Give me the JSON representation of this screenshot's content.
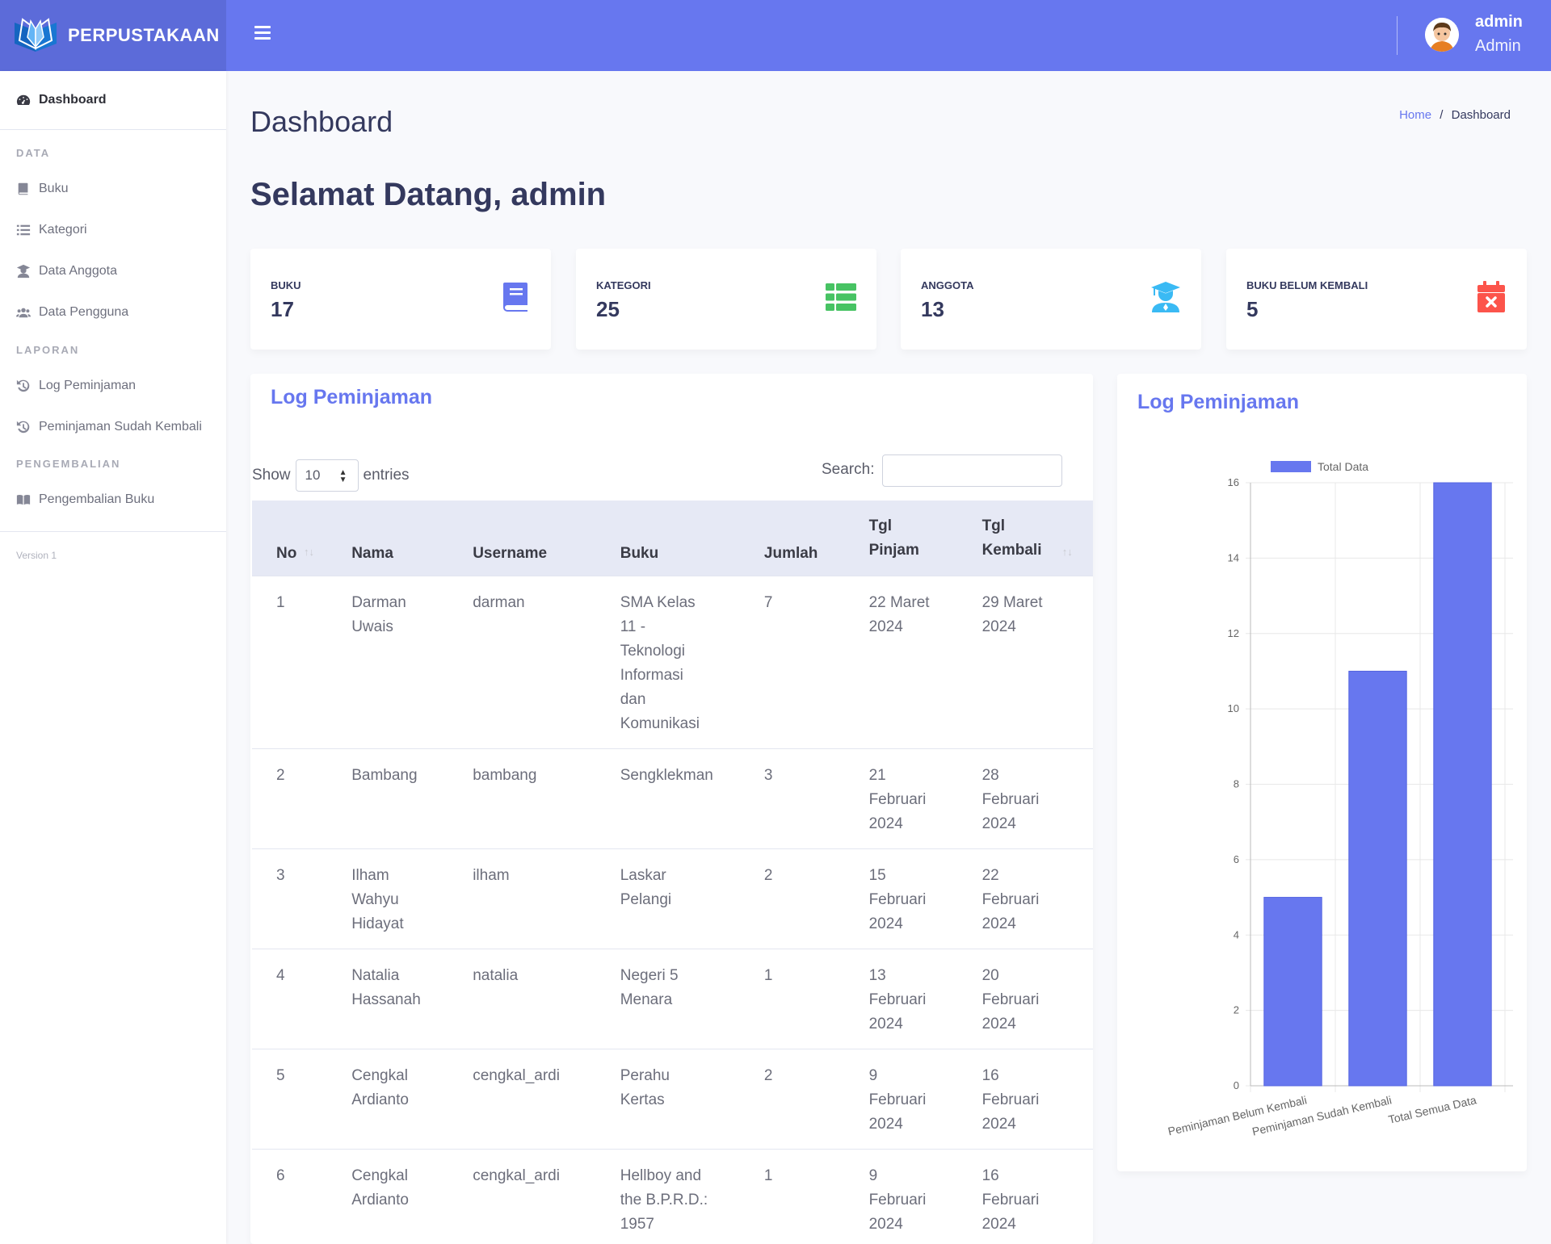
{
  "app": {
    "brand": "PERPUSTAKAAN"
  },
  "user": {
    "name": "admin",
    "role": "Admin"
  },
  "sidebar": {
    "dashboard": "Dashboard",
    "data_heading": "DATA",
    "items_data": [
      "Buku",
      "Kategori",
      "Data Anggota",
      "Data Pengguna"
    ],
    "laporan_heading": "LAPORAN",
    "items_laporan": [
      "Log Peminjaman",
      "Peminjaman Sudah Kembali"
    ],
    "pengembalian_heading": "PENGEMBALIAN",
    "items_pengembalian": [
      "Pengembalian Buku"
    ],
    "version": "Version 1"
  },
  "page": {
    "title": "Dashboard",
    "welcome": "Selamat Datang, admin"
  },
  "breadcrumb": {
    "home": "Home",
    "separator": "/",
    "current": "Dashboard"
  },
  "stats": [
    {
      "label": "BUKU",
      "value": "17",
      "color": "#6777ef",
      "icon": "book-icon"
    },
    {
      "label": "KATEGORI",
      "value": "25",
      "color": "#63ed7a",
      "icon": "table-list-icon"
    },
    {
      "label": "ANGGOTA",
      "value": "13",
      "color": "#3abaf4",
      "icon": "user-graduate-icon"
    },
    {
      "label": "BUKU BELUM KEMBALI",
      "value": "5",
      "color": "#fc544b",
      "icon": "calendar-x-icon"
    }
  ],
  "log_table": {
    "title": "Log Peminjaman",
    "show_label": "Show",
    "page_size": "10",
    "entries_label": "entries",
    "search_label": "Search:",
    "columns": [
      "No",
      "Nama",
      "Username",
      "Buku",
      "Jumlah",
      "Tgl Pinjam",
      "Tgl Kembali"
    ],
    "rows": [
      {
        "no": "1",
        "nama": "Darman Uwais",
        "username": "darman",
        "buku": "SMA Kelas 11 - Teknologi Informasi dan Komunikasi",
        "jumlah": "7",
        "tgl_pinjam": "22 Maret 2024",
        "tgl_kembali": "29 Maret 2024"
      },
      {
        "no": "2",
        "nama": "Bambang",
        "username": "bambang",
        "buku": "Sengklekman",
        "jumlah": "3",
        "tgl_pinjam": "21 Februari 2024",
        "tgl_kembali": "28 Februari 2024"
      },
      {
        "no": "3",
        "nama": "Ilham Wahyu Hidayat",
        "username": "ilham",
        "buku": "Laskar Pelangi",
        "jumlah": "2",
        "tgl_pinjam": "15 Februari 2024",
        "tgl_kembali": "22 Februari 2024"
      },
      {
        "no": "4",
        "nama": "Natalia Hassanah",
        "username": "natalia",
        "buku": "Negeri 5 Menara",
        "jumlah": "1",
        "tgl_pinjam": "13 Februari 2024",
        "tgl_kembali": "20 Februari 2024"
      },
      {
        "no": "5",
        "nama": "Cengkal Ardianto",
        "username": "cengkal_ardi",
        "buku": "Perahu Kertas",
        "jumlah": "2",
        "tgl_pinjam": "9 Februari 2024",
        "tgl_kembali": "16 Februari 2024"
      },
      {
        "no": "6",
        "nama": "Cengkal Ardianto",
        "username": "cengkal_ardi",
        "buku": "Hellboy and the B.P.R.D.: 1957",
        "jumlah": "1",
        "tgl_pinjam": "9 Februari 2024",
        "tgl_kembali": "16 Februari 2024"
      }
    ]
  },
  "chart_panel": {
    "title": "Log Peminjaman"
  },
  "chart_data": {
    "type": "bar",
    "categories": [
      "Peminjaman Belum Kembali",
      "Peminjaman Sudah Kembali",
      "Total Semua Data"
    ],
    "series": [
      {
        "name": "Total Data",
        "values": [
          5,
          11,
          16
        ],
        "color": "#6777ef"
      }
    ],
    "ylim": [
      0,
      16
    ],
    "yticks": [
      0,
      2,
      4,
      6,
      8,
      10,
      12,
      14,
      16
    ],
    "grid": true,
    "legend": "top"
  }
}
